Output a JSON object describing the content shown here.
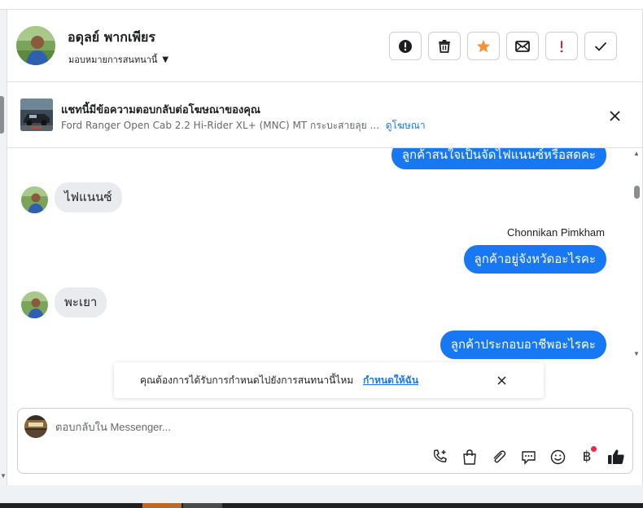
{
  "header": {
    "contact_name": "อดุลย์ พากเพียร",
    "assign_label": "มอบหมายการสนทนานี้",
    "actions": [
      {
        "name": "report-button",
        "icon": "exclamation-circle-icon"
      },
      {
        "name": "delete-button",
        "icon": "trash-icon"
      },
      {
        "name": "star-button",
        "icon": "star-icon",
        "color": "#f7923a"
      },
      {
        "name": "mark-unread-button",
        "icon": "envelope-icon"
      },
      {
        "name": "follow-up-button",
        "icon": "exclamation-icon",
        "color": "#e41e3f"
      },
      {
        "name": "done-button",
        "icon": "check-icon"
      }
    ]
  },
  "ad_banner": {
    "title": "แชทนี้มีข้อความตอบกลับต่อโฆษณาของคุณ",
    "subtitle": "Ford Ranger Open Cab 2.2 Hi-Rider XL+ (MNC) MT กระบะสายลุย ...",
    "link": "ดูโฆษณา"
  },
  "messages": [
    {
      "from": "page",
      "text": "ลูกค้าสนใจเป็นจัดไฟแนนซ์หรือสดคะ"
    },
    {
      "from": "customer",
      "text": "ไฟแนนซ์"
    },
    {
      "from": "page",
      "sender": "Chonnikan Pimkham",
      "text": "ลูกค้าอยู่จังหวัดอะไรคะ"
    },
    {
      "from": "customer",
      "text": "พะเยา"
    },
    {
      "from": "page",
      "text": "ลูกค้าประกอบอาชีพอะไรคะ"
    }
  ],
  "toast": {
    "text": "คุณต้องการได้รับการกำหนดไปยังการสนทนานี้ไหม",
    "link": "กำหนดให้ฉัน"
  },
  "composer": {
    "placeholder": "ตอบกลับใน Messenger...",
    "value": "",
    "tools": [
      "phone-add-icon",
      "shopping-bag-icon",
      "paperclip-icon",
      "chat-bubble-icon",
      "smiley-icon",
      "baht-icon",
      "thumbs-up-icon"
    ],
    "baht_symbol": "฿"
  },
  "colors": {
    "accent": "#1877f2",
    "incoming_bubble": "#e9ebee",
    "star": "#f7923a",
    "alert": "#e41e3f"
  }
}
